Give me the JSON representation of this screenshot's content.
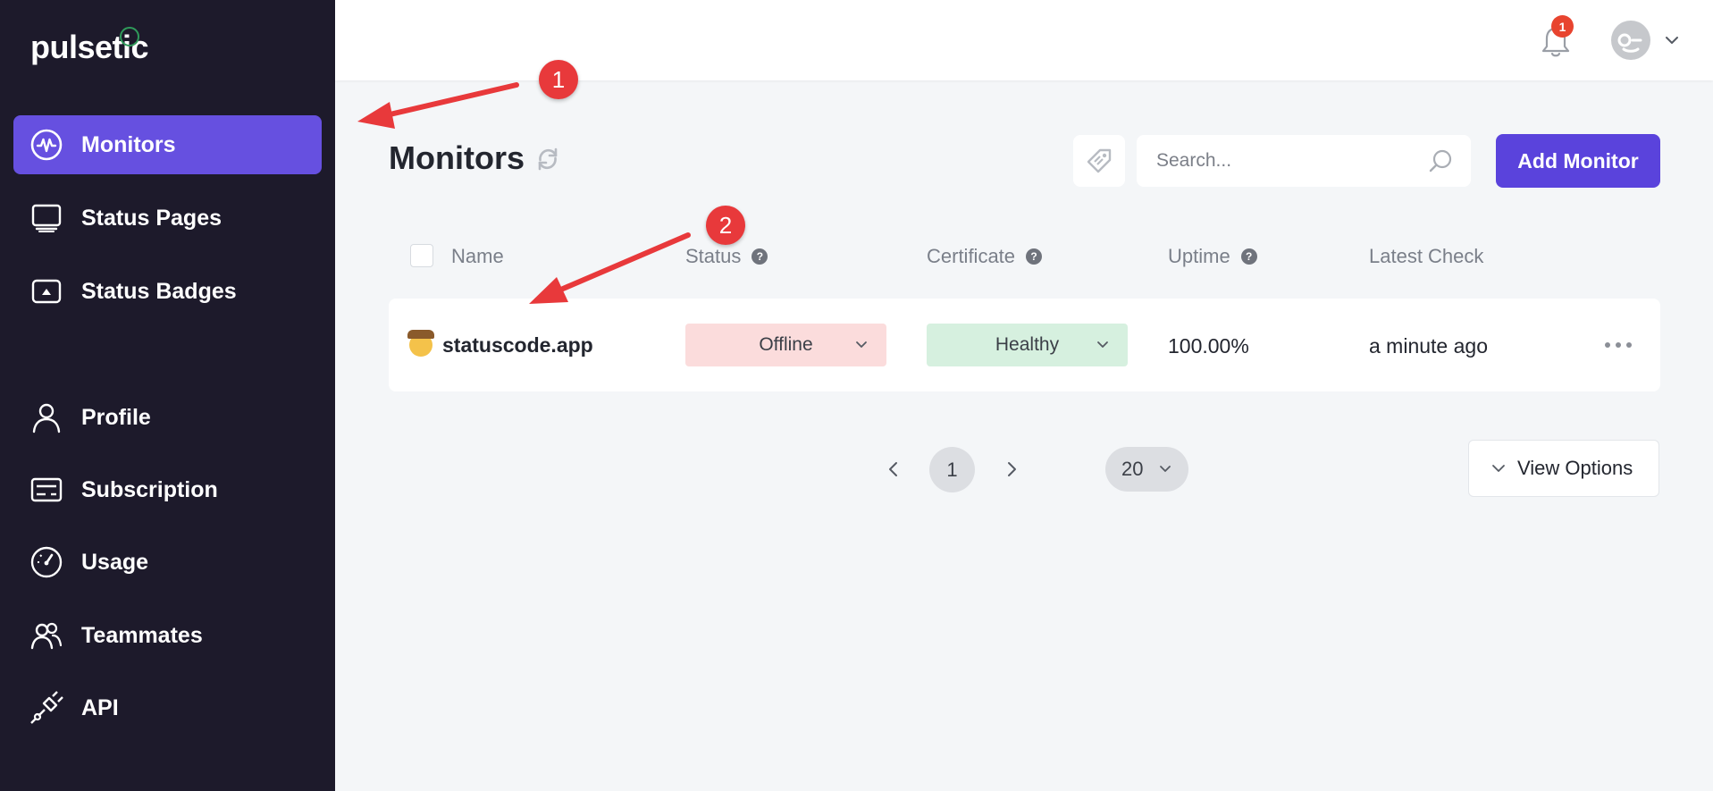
{
  "app": {
    "logo": "pulsetic"
  },
  "sidebar": {
    "items": [
      {
        "label": "Monitors",
        "icon": "pulse-icon",
        "active": true
      },
      {
        "label": "Status Pages",
        "icon": "monitor-icon"
      },
      {
        "label": "Status Badges",
        "icon": "badge-icon"
      },
      {
        "label": "Profile",
        "icon": "user-icon"
      },
      {
        "label": "Subscription",
        "icon": "card-icon"
      },
      {
        "label": "Usage",
        "icon": "gauge-icon"
      },
      {
        "label": "Teammates",
        "icon": "users-icon"
      },
      {
        "label": "API",
        "icon": "plug-icon"
      }
    ]
  },
  "topbar": {
    "notification_count": "1"
  },
  "main": {
    "title": "Monitors",
    "search": {
      "placeholder": "Search..."
    },
    "add_button": "Add Monitor",
    "table": {
      "columns": [
        "Name",
        "Status",
        "Certificate",
        "Uptime",
        "Latest Check"
      ],
      "rows": [
        {
          "name": "statuscode.app",
          "status": "Offline",
          "certificate": "Healthy",
          "uptime": "100.00%",
          "latest_check": "a minute ago"
        }
      ]
    },
    "pagination": {
      "current_page": "1",
      "per_page": "20"
    },
    "view_options": "View Options"
  },
  "annotations": [
    "1",
    "2"
  ],
  "colors": {
    "accent": "#5a43dc",
    "sidebar_bg": "#1d1a2b",
    "offline_bg": "#fbdcdc",
    "healthy_bg": "#d6f0df",
    "annotation": "#e8393b"
  }
}
